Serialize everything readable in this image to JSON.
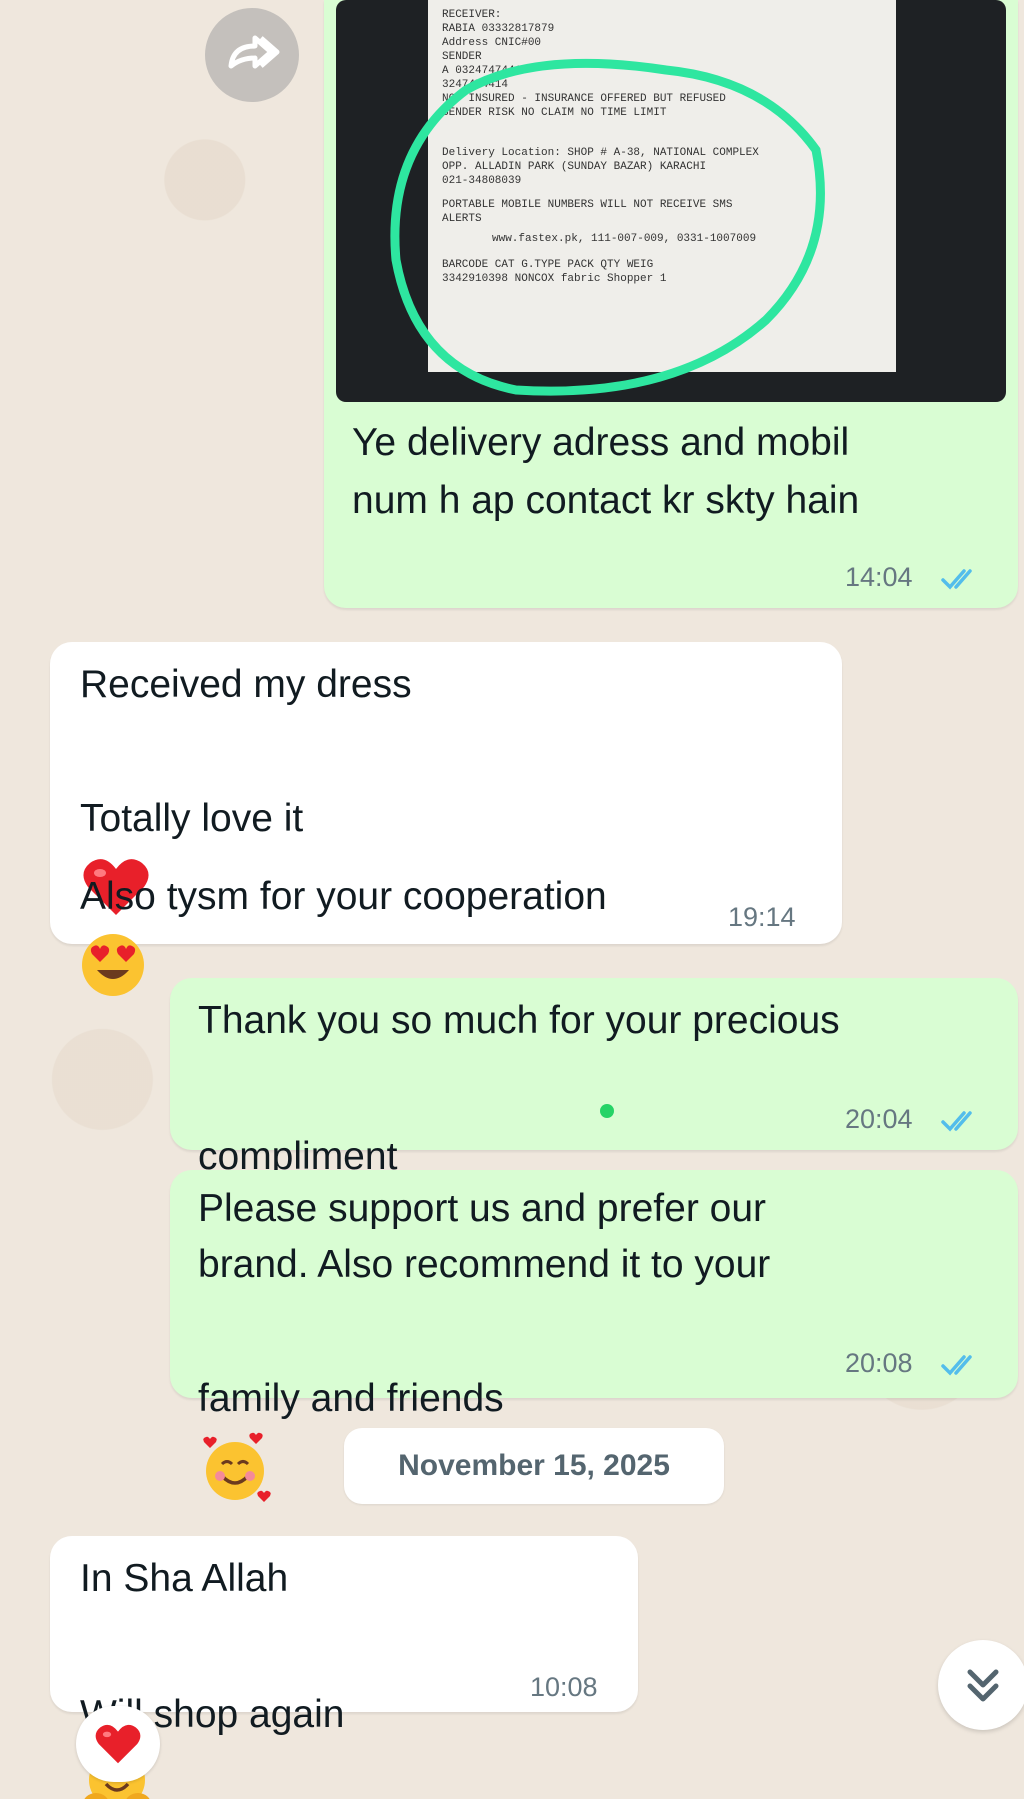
{
  "receipt": {
    "lines": [
      "RECEIVER:",
      "RABIA 03332817879",
      "Address  CNIC#00",
      "SENDER",
      "A  03247474414",
      "3247474414",
      "NOT INSURED - INSURANCE OFFERED BUT REFUSED",
      "SENDER RISK NO CLAIM NO TIME LIMIT",
      "",
      "Delivery Location: SHOP # A-38, NATIONAL COMPLEX",
      "OPP. ALLADIN PARK (SUNDAY BAZAR) KARACHI",
      "021-34808039",
      "PORTABLE MOBILE NUMBERS WILL NOT RECEIVE SMS",
      "ALERTS",
      "www.fastex.pk, 111-007-009, 0331-1007009",
      "",
      "BARCODE    CAT   G.TYPE  PACK  QTY WEIG",
      "3342910398 NONCOX  fabric Shopper  1"
    ]
  },
  "messages": [
    {
      "text": "Ye delivery adress and mobil\nnum h ap contact kr skty hain",
      "time": "14:04"
    },
    {
      "line1": "Received my dress",
      "line2": "Totally love it",
      "line3": "Also tysm for your cooperation",
      "time": "19:14"
    },
    {
      "line1": "Thank you so much for your precious",
      "line2": "compliment",
      "time": "20:04"
    },
    {
      "line1": "Please support us and prefer our",
      "line2": "brand. Also recommend it to your",
      "line3": "family and friends",
      "time": "20:08"
    },
    {
      "line1": "In Sha Allah",
      "line2": "Will shop again",
      "time": "10:08"
    }
  ],
  "date_separator": "November 15, 2025",
  "icons": {
    "forward": "forward-icon",
    "ticks": "double-check-icon",
    "heart": "heart-emoji-icon",
    "heart_eyes": "heart-eyes-emoji-icon",
    "hearts_face": "smiling-face-with-hearts-icon",
    "hug": "hugging-face-icon",
    "scroll": "chevron-double-down-icon"
  },
  "colors": {
    "outgoing": "#d9fdd3",
    "incoming": "#ffffff",
    "read_ticks": "#53bdeb",
    "highlight": "#2ee6a0"
  }
}
